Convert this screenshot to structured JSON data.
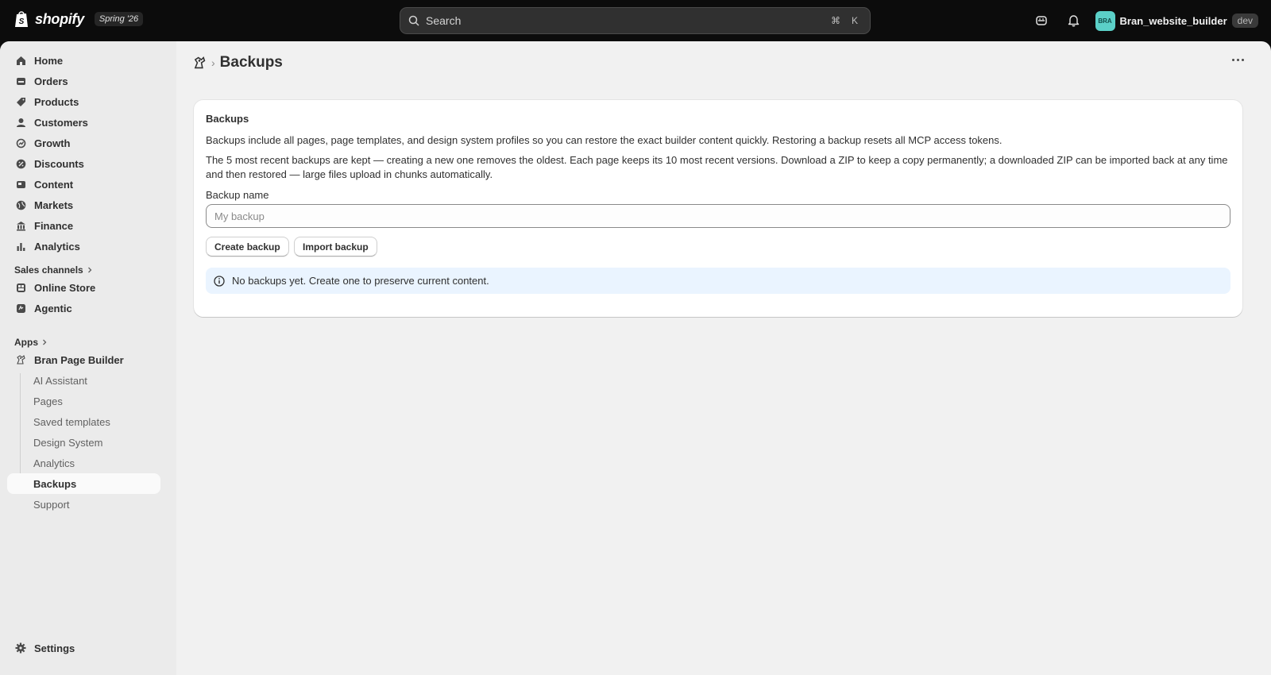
{
  "topbar": {
    "brand": "shopify",
    "edition": "Spring '26",
    "search_placeholder": "Search",
    "shortcut_keys": [
      "⌘",
      "K"
    ],
    "user": {
      "initials": "BRA",
      "name": "Bran_website_builder",
      "badge": "dev"
    }
  },
  "sidebar": {
    "main_items": [
      {
        "label": "Home",
        "icon": "home-icon"
      },
      {
        "label": "Orders",
        "icon": "orders-icon"
      },
      {
        "label": "Products",
        "icon": "tag-icon"
      },
      {
        "label": "Customers",
        "icon": "person-icon"
      },
      {
        "label": "Growth",
        "icon": "growth-icon"
      },
      {
        "label": "Discounts",
        "icon": "discount-icon"
      },
      {
        "label": "Content",
        "icon": "content-icon"
      },
      {
        "label": "Markets",
        "icon": "globe-icon"
      },
      {
        "label": "Finance",
        "icon": "bank-icon"
      },
      {
        "label": "Analytics",
        "icon": "bar-chart-icon"
      }
    ],
    "sales_channels_label": "Sales channels",
    "channels": [
      {
        "label": "Online Store",
        "icon": "store-icon"
      },
      {
        "label": "Agentic",
        "icon": "agentic-icon"
      }
    ],
    "apps_label": "Apps",
    "app_name": "Bran Page Builder",
    "app_items": [
      "AI Assistant",
      "Pages",
      "Saved templates",
      "Design System",
      "Analytics",
      "Backups",
      "Support"
    ],
    "active_item": "Backups",
    "settings_label": "Settings"
  },
  "page": {
    "title": "Backups",
    "card": {
      "title": "Backups",
      "description": "Backups include all pages, page templates, and design system profiles so you can restore the exact builder content quickly. Restoring a backup resets all MCP access tokens.",
      "retention": "The 5 most recent backups are kept — creating a new one removes the oldest. Each page keeps its 10 most recent versions. Download a ZIP to keep a copy permanently; a downloaded ZIP can be imported back at any time and then restored — large files upload in chunks automatically.",
      "name_label": "Backup name",
      "name_placeholder": "My backup",
      "create_label": "Create backup",
      "import_label": "Import backup",
      "empty_message": "No backups yet. Create one to preserve current content."
    }
  }
}
